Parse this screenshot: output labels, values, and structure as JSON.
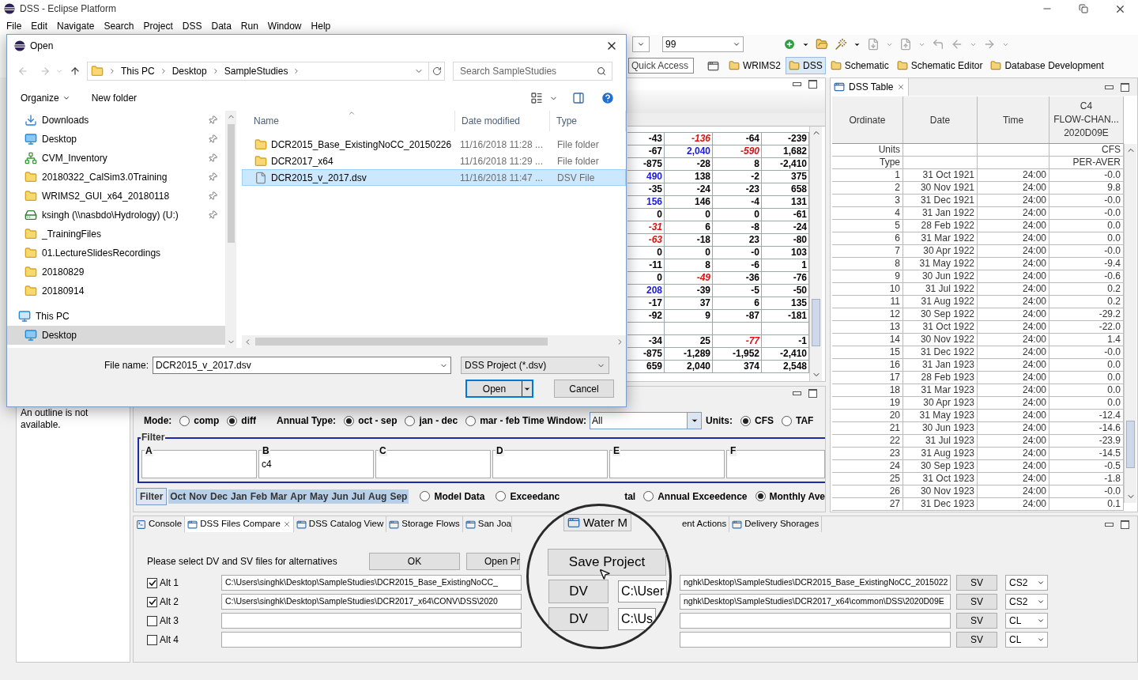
{
  "window": {
    "title": "DSS - Eclipse Platform"
  },
  "menu": [
    "File",
    "Edit",
    "Navigate",
    "Search",
    "Project",
    "DSS",
    "Data",
    "Run",
    "Window",
    "Help"
  ],
  "toolbar": {
    "combo_value": "99",
    "quick_access": "Quick Access",
    "perspectives": [
      {
        "label": "WRIMS2",
        "selected": false
      },
      {
        "label": "DSS",
        "selected": true
      },
      {
        "label": "Schematic",
        "selected": false
      },
      {
        "label": "Schematic Editor",
        "selected": false
      },
      {
        "label": "Database Development",
        "selected": false
      }
    ]
  },
  "open_dialog": {
    "title": "Open",
    "path": [
      "This PC",
      "Desktop",
      "SampleStudies"
    ],
    "search_placeholder": "Search SampleStudies",
    "organize": "Organize",
    "new_folder": "New folder",
    "nav": [
      {
        "label": "Downloads",
        "kind": "download",
        "pinned": true,
        "selected": false
      },
      {
        "label": "Desktop",
        "kind": "desktop",
        "pinned": true,
        "selected": false
      },
      {
        "label": "CVM_Inventory",
        "kind": "share",
        "pinned": true,
        "selected": false
      },
      {
        "label": "20180322_CalSim3.0Training",
        "kind": "folder",
        "pinned": true,
        "selected": false
      },
      {
        "label": "WRIMS2_GUI_x64_20180118",
        "kind": "folder",
        "pinned": true,
        "selected": false
      },
      {
        "label": "ksingh (\\\\nasbdo\\Hydrology) (U:)",
        "kind": "drive",
        "pinned": true,
        "selected": false
      },
      {
        "label": "_TrainingFiles",
        "kind": "folder",
        "pinned": false,
        "selected": false
      },
      {
        "label": "01.LectureSlidesRecordings",
        "kind": "folder",
        "pinned": false,
        "selected": false
      },
      {
        "label": "20180829",
        "kind": "folder",
        "pinned": false,
        "selected": false
      },
      {
        "label": "20180914",
        "kind": "folder",
        "pinned": false,
        "selected": false
      },
      {
        "label": "This PC",
        "kind": "pc",
        "pinned": false,
        "selected": false,
        "children": [
          {
            "label": "Desktop",
            "kind": "desktop",
            "pinned": false,
            "selected": true
          }
        ]
      }
    ],
    "columns": [
      "Name",
      "Date modified",
      "Type"
    ],
    "files": [
      {
        "name": "DCR2015_Base_ExistingNoCC_20150226",
        "date": "11/16/2018 11:28 ...",
        "type": "File folder",
        "kind": "folder",
        "selected": false
      },
      {
        "name": "DCR2017_x64",
        "date": "11/16/2018 11:29 ...",
        "type": "File folder",
        "kind": "folder",
        "selected": false
      },
      {
        "name": "DCR2015_v_2017.dsv",
        "date": "11/16/2018 11:47 ...",
        "type": "DSV File",
        "kind": "file",
        "selected": true
      }
    ],
    "file_name_label": "File name:",
    "file_name": "DCR2015_v_2017.dsv",
    "file_type": "DSS Project (*.dsv)",
    "open": "Open",
    "cancel": "Cancel"
  },
  "compare_table": {
    "rows": [
      {
        "kind": "data",
        "cells": [
          {
            "text": "-43",
            "kind": "plain"
          },
          {
            "text": "-136",
            "kind": "low"
          },
          {
            "text": "-64",
            "kind": "plain"
          },
          {
            "text": "-239",
            "kind": "plain"
          }
        ]
      },
      {
        "kind": "data",
        "cells": [
          {
            "text": "-67",
            "kind": "plain"
          },
          {
            "text": "2,040",
            "kind": "high"
          },
          {
            "text": "-590",
            "kind": "low"
          },
          {
            "text": "1,682",
            "kind": "plain"
          }
        ]
      },
      {
        "kind": "data",
        "cells": [
          {
            "text": "-875",
            "kind": "plain"
          },
          {
            "text": "-28",
            "kind": "plain"
          },
          {
            "text": "8",
            "kind": "plain"
          },
          {
            "text": "-2,410",
            "kind": "plain"
          }
        ]
      },
      {
        "kind": "data",
        "cells": [
          {
            "text": "490",
            "kind": "high"
          },
          {
            "text": "138",
            "kind": "plain"
          },
          {
            "text": "-2",
            "kind": "plain"
          },
          {
            "text": "375",
            "kind": "plain"
          }
        ]
      },
      {
        "kind": "data",
        "cells": [
          {
            "text": "-35",
            "kind": "plain"
          },
          {
            "text": "-24",
            "kind": "plain"
          },
          {
            "text": "-23",
            "kind": "plain"
          },
          {
            "text": "658",
            "kind": "plain"
          }
        ]
      },
      {
        "kind": "data",
        "cells": [
          {
            "text": "156",
            "kind": "high"
          },
          {
            "text": "146",
            "kind": "plain"
          },
          {
            "text": "-4",
            "kind": "plain"
          },
          {
            "text": "131",
            "kind": "plain"
          }
        ]
      },
      {
        "kind": "data",
        "cells": [
          {
            "text": "0",
            "kind": "plain"
          },
          {
            "text": "0",
            "kind": "plain"
          },
          {
            "text": "0",
            "kind": "plain"
          },
          {
            "text": "-61",
            "kind": "plain"
          }
        ]
      },
      {
        "kind": "data",
        "cells": [
          {
            "text": "-31",
            "kind": "low"
          },
          {
            "text": "6",
            "kind": "plain"
          },
          {
            "text": "-8",
            "kind": "plain"
          },
          {
            "text": "-24",
            "kind": "plain"
          }
        ]
      },
      {
        "kind": "data",
        "cells": [
          {
            "text": "-63",
            "kind": "low"
          },
          {
            "text": "-18",
            "kind": "plain"
          },
          {
            "text": "23",
            "kind": "plain"
          },
          {
            "text": "-80",
            "kind": "plain"
          }
        ]
      },
      {
        "kind": "data",
        "cells": [
          {
            "text": "0",
            "kind": "plain"
          },
          {
            "text": "0",
            "kind": "plain"
          },
          {
            "text": "-0",
            "kind": "plain"
          },
          {
            "text": "103",
            "kind": "plain"
          }
        ]
      },
      {
        "kind": "data",
        "cells": [
          {
            "text": "-11",
            "kind": "plain"
          },
          {
            "text": "8",
            "kind": "plain"
          },
          {
            "text": "-6",
            "kind": "plain"
          },
          {
            "text": "1",
            "kind": "plain"
          }
        ]
      },
      {
        "kind": "data",
        "cells": [
          {
            "text": "0",
            "kind": "plain"
          },
          {
            "text": "-49",
            "kind": "low"
          },
          {
            "text": "-36",
            "kind": "plain"
          },
          {
            "text": "-76",
            "kind": "plain"
          }
        ]
      },
      {
        "kind": "data",
        "cells": [
          {
            "text": "208",
            "kind": "high"
          },
          {
            "text": "-39",
            "kind": "plain"
          },
          {
            "text": "-5",
            "kind": "plain"
          },
          {
            "text": "-50",
            "kind": "plain"
          }
        ]
      },
      {
        "kind": "data",
        "cells": [
          {
            "text": "-17",
            "kind": "plain"
          },
          {
            "text": "37",
            "kind": "plain"
          },
          {
            "text": "6",
            "kind": "plain"
          },
          {
            "text": "135",
            "kind": "plain"
          }
        ]
      },
      {
        "kind": "data",
        "cells": [
          {
            "text": "-92",
            "kind": "plain"
          },
          {
            "text": "9",
            "kind": "plain"
          },
          {
            "text": "-87",
            "kind": "plain"
          },
          {
            "text": "-181",
            "kind": "plain"
          }
        ]
      },
      {
        "kind": "gap"
      },
      {
        "kind": "data",
        "cells": [
          {
            "text": "-34",
            "kind": "plain"
          },
          {
            "text": "25",
            "kind": "plain"
          },
          {
            "text": "-77",
            "kind": "low"
          },
          {
            "text": "-1",
            "kind": "plain"
          }
        ]
      },
      {
        "kind": "data",
        "cells": [
          {
            "text": "-875",
            "kind": "plain"
          },
          {
            "text": "-1,289",
            "kind": "plain"
          },
          {
            "text": "-1,952",
            "kind": "plain"
          },
          {
            "text": "-2,410",
            "kind": "plain"
          }
        ]
      },
      {
        "kind": "data",
        "cells": [
          {
            "text": "659",
            "kind": "plain"
          },
          {
            "text": "2,040",
            "kind": "plain"
          },
          {
            "text": "374",
            "kind": "plain"
          },
          {
            "text": "2,548",
            "kind": "plain"
          }
        ]
      }
    ]
  },
  "outline": {
    "message": "An outline is not available."
  },
  "options": {
    "mode": {
      "label": "Mode:",
      "options": [
        {
          "label": "comp",
          "selected": false
        },
        {
          "label": "diff",
          "selected": true
        }
      ]
    },
    "annual_type": {
      "label": "Annual Type:",
      "options": [
        {
          "label": "oct - sep",
          "selected": true
        },
        {
          "label": "jan - dec",
          "selected": false
        },
        {
          "label": "mar - feb",
          "selected": false
        }
      ]
    },
    "time_window": {
      "label": "Time Window:",
      "value": "All"
    },
    "units": {
      "label": "Units:",
      "options": [
        {
          "label": "CFS",
          "selected": true
        },
        {
          "label": "TAF",
          "selected": false
        }
      ]
    }
  },
  "filter": {
    "title": "Filter",
    "fields": [
      {
        "label": "A"
      },
      {
        "label": "B",
        "value": "c4"
      },
      {
        "label": "C"
      },
      {
        "label": "D"
      },
      {
        "label": "E"
      },
      {
        "label": "F"
      }
    ]
  },
  "filter_bar": {
    "button": "Filter",
    "months": [
      {
        "label": "Oct",
        "selected": true
      },
      {
        "label": "Nov",
        "selected": true
      },
      {
        "label": "Dec",
        "selected": true
      },
      {
        "label": "Jan",
        "selected": true
      },
      {
        "label": "Feb",
        "selected": true
      },
      {
        "label": "Mar",
        "selected": true
      },
      {
        "label": "Apr",
        "selected": true
      },
      {
        "label": "May",
        "selected": true
      },
      {
        "label": "Jun",
        "selected": true
      },
      {
        "label": "Jul",
        "selected": true
      },
      {
        "label": "Aug",
        "selected": true
      },
      {
        "label": "Sep",
        "selected": true
      }
    ],
    "views_left": [
      {
        "label": "Model Data",
        "selected": false
      },
      {
        "label": "Exceedanc",
        "selected": false
      }
    ],
    "partial_label": "tal",
    "views_right": [
      {
        "label": "Annual Exceedence",
        "selected": false
      },
      {
        "label": "Monthly Ave",
        "selected": true
      }
    ]
  },
  "bottom_tabs_left": [
    {
      "label": "Console",
      "kind": "console",
      "selected": false
    },
    {
      "label": "DSS Files Compare",
      "kind": "view",
      "selected": true
    },
    {
      "label": "DSS Catalog View",
      "kind": "view",
      "selected": false
    },
    {
      "label": "Storage Flows",
      "kind": "view",
      "selected": false
    },
    {
      "label": "San Joa",
      "kind": "view",
      "selected": false
    }
  ],
  "bottom_tabs_right": [
    {
      "label": "ent Actions",
      "kind": "plain",
      "selected": false
    },
    {
      "label": "Delivery Shorages",
      "kind": "view",
      "selected": false
    }
  ],
  "compare_files": {
    "prompt": "Please select DV and SV files for alternatives",
    "ok": "OK",
    "open_project": "Open Pr",
    "alternatives": [
      {
        "label": "Alt 1",
        "checked": true,
        "dv_path": "C:\\Users\\singhk\\Desktop\\SampleStudies\\DCR2015_Base_ExistingNoCC_",
        "sv_path": "nghk\\Desktop\\SampleStudies\\DCR2015_Base_ExistingNoCC_2015022",
        "sv_button": "SV",
        "type": "CS2"
      },
      {
        "label": "Alt 2",
        "checked": true,
        "dv_path": "C:\\Users\\singhk\\Desktop\\SampleStudies\\DCR2017_x64\\CONV\\DSS\\2020",
        "sv_path": "nghk\\Desktop\\SampleStudies\\DCR2017_x64\\common\\DSS\\2020D09E",
        "sv_button": "SV",
        "type": "CS2"
      },
      {
        "label": "Alt 3",
        "checked": false,
        "sv_button": "SV",
        "type": "CL"
      },
      {
        "label": "Alt 4",
        "checked": false,
        "sv_button": "SV",
        "type": "CL"
      }
    ]
  },
  "magnifier": {
    "tab": "Water M",
    "button": "Save Project",
    "rows": [
      {
        "button": "DV",
        "path": "C:\\User"
      },
      {
        "button": "DV",
        "path": "C:\\Us"
      }
    ]
  },
  "dss_table": {
    "tab": "DSS Table",
    "columns": [
      "Ordinate",
      "Date",
      "Time"
    ],
    "value_header": [
      "C4",
      "FLOW-CHAN...",
      "2020D09E"
    ],
    "meta": [
      {
        "label": "Units",
        "value": "CFS"
      },
      {
        "label": "Type",
        "value": "PER-AVER"
      }
    ],
    "rows": [
      [
        "1",
        "31 Oct 1921",
        "24:00",
        "-0.0"
      ],
      [
        "2",
        "30 Nov 1921",
        "24:00",
        "9.8"
      ],
      [
        "3",
        "31 Dec 1921",
        "24:00",
        "-0.0"
      ],
      [
        "4",
        "31 Jan 1922",
        "24:00",
        "-0.0"
      ],
      [
        "5",
        "28 Feb 1922",
        "24:00",
        "0.0"
      ],
      [
        "6",
        "31 Mar 1922",
        "24:00",
        "0.0"
      ],
      [
        "7",
        "30 Apr 1922",
        "24:00",
        "-0.0"
      ],
      [
        "8",
        "31 May 1922",
        "24:00",
        "-9.4"
      ],
      [
        "9",
        "30 Jun 1922",
        "24:00",
        "-0.6"
      ],
      [
        "10",
        "31 Jul 1922",
        "24:00",
        "0.2"
      ],
      [
        "11",
        "31 Aug 1922",
        "24:00",
        "0.2"
      ],
      [
        "12",
        "30 Sep 1922",
        "24:00",
        "-29.2"
      ],
      [
        "13",
        "31 Oct 1922",
        "24:00",
        "-22.0"
      ],
      [
        "14",
        "30 Nov 1922",
        "24:00",
        "1.4"
      ],
      [
        "15",
        "31 Dec 1922",
        "24:00",
        "-0.0"
      ],
      [
        "16",
        "31 Jan 1923",
        "24:00",
        "0.0"
      ],
      [
        "17",
        "28 Feb 1923",
        "24:00",
        "0.0"
      ],
      [
        "18",
        "31 Mar 1923",
        "24:00",
        "0.0"
      ],
      [
        "19",
        "30 Apr 1923",
        "24:00",
        "0.0"
      ],
      [
        "20",
        "31 May 1923",
        "24:00",
        "-12.4"
      ],
      [
        "21",
        "30 Jun 1923",
        "24:00",
        "-14.6"
      ],
      [
        "22",
        "31 Jul 1923",
        "24:00",
        "-23.9"
      ],
      [
        "23",
        "31 Aug 1923",
        "24:00",
        "-14.5"
      ],
      [
        "24",
        "30 Sep 1923",
        "24:00",
        "-0.5"
      ],
      [
        "25",
        "31 Oct 1923",
        "24:00",
        "-1.8"
      ],
      [
        "26",
        "30 Nov 1923",
        "24:00",
        "-0.0"
      ],
      [
        "27",
        "31 Dec 1923",
        "24:00",
        "0.1"
      ]
    ]
  }
}
